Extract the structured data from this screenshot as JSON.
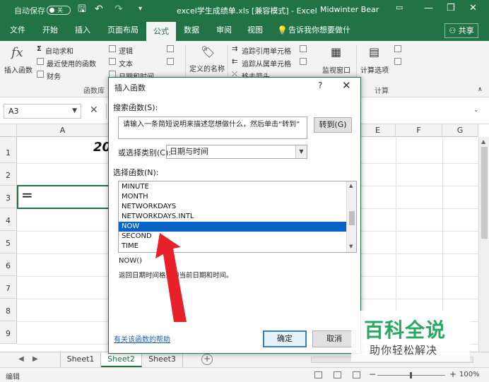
{
  "titlebar": {
    "autosave_label": "自动保存",
    "autosave_state": "关",
    "title": "excel学生成绩单.xls  [兼容模式]  -  Excel",
    "user": "Midwinter Bear",
    "icons": [
      "save-icon",
      "undo-icon",
      "redo-icon",
      "customize-icon",
      "ribbon-display-icon",
      "minimize-icon",
      "restore-icon",
      "close-icon"
    ]
  },
  "tabs": [
    {
      "label": "文件"
    },
    {
      "label": "开始"
    },
    {
      "label": "插入"
    },
    {
      "label": "页面布局"
    },
    {
      "label": "公式"
    },
    {
      "label": "数据"
    },
    {
      "label": "审阅"
    },
    {
      "label": "视图"
    },
    {
      "label": "告诉我你想要做什么"
    }
  ],
  "active_tab": "公式",
  "share_label": "共享",
  "ribbon": {
    "insert_function": "插入函数",
    "autosum": "自动求和",
    "recent": "最近使用的函数",
    "financial": "财务",
    "logical": "逻辑",
    "text": "文本",
    "datetime": "日期和时间",
    "library_group": "函数库",
    "define_name": "定义的名称",
    "trace_precedents": "追踪引用单元格",
    "trace_dependents": "追踪从属单元格",
    "remove_arrows": "移去箭头",
    "watch_window": "监视窗口",
    "calc_options": "计算选项",
    "calc_group": "计算"
  },
  "formula_bar": {
    "name_box": "A3",
    "cancel_symbol": "✕"
  },
  "grid": {
    "columns": [
      "A",
      "E",
      "F",
      "G"
    ],
    "rows": [
      "1",
      "2",
      "3",
      "4",
      "5",
      "6",
      "7",
      "8",
      "9"
    ],
    "cell_a1_partial": "20",
    "cell_a3": "="
  },
  "sheets": [
    {
      "label": "Sheet1"
    },
    {
      "label": "Sheet2"
    },
    {
      "label": "Sheet3"
    }
  ],
  "active_sheet": "Sheet2",
  "status": {
    "mode": "编辑",
    "zoom": "100%"
  },
  "dialog": {
    "title": "插入函数",
    "help_symbol": "?",
    "search_label": "搜索函数(S):",
    "search_value": "请输入一条简短说明来描述您想做什么，然后单击“转到”",
    "goto_label": "转到(G)",
    "category_label": "或选择类别(C):",
    "category_value": "日期与时间",
    "select_label": "选择函数(N):",
    "functions": [
      "MINUTE",
      "MONTH",
      "NETWORKDAYS",
      "NETWORKDAYS.INTL",
      "NOW",
      "SECOND",
      "TIME"
    ],
    "selected_function": "NOW",
    "signature": "NOW()",
    "description": "返回日期时间格式的当前日期和时间。",
    "help_link": "有关该函数的帮助",
    "ok_label": "确定",
    "cancel_label": "取消"
  },
  "watermark": {
    "title": "百科全说",
    "subtitle": "助你轻松解决"
  },
  "colors": {
    "brand": "#217346",
    "selection": "#0a64c8",
    "arrow": "#e8202a",
    "watermark": "#2aa861"
  }
}
